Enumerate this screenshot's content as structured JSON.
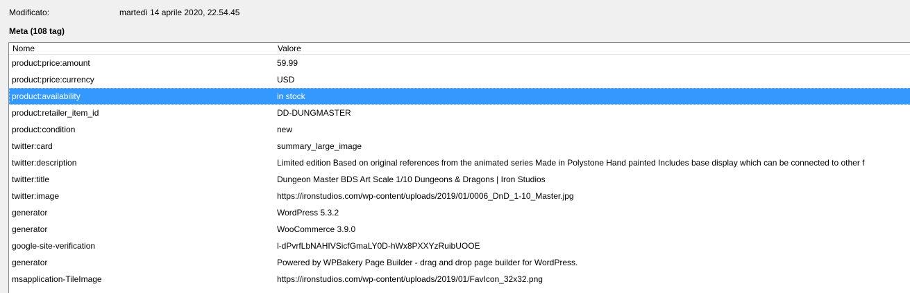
{
  "modified": {
    "label": "Modificato:",
    "value": "martedì 14 aprile 2020, 22.54.45"
  },
  "meta_section": {
    "title": "Meta (108 tag)"
  },
  "table": {
    "columns": [
      "Nome",
      "Valore"
    ],
    "selected_index": 2,
    "rows": [
      {
        "name": "product:price:amount",
        "value": "59.99"
      },
      {
        "name": "product:price:currency",
        "value": "USD"
      },
      {
        "name": "product:availability",
        "value": "in stock"
      },
      {
        "name": "product:retailer_item_id",
        "value": "DD-DUNGMASTER"
      },
      {
        "name": "product:condition",
        "value": "new"
      },
      {
        "name": "twitter:card",
        "value": "summary_large_image"
      },
      {
        "name": "twitter:description",
        "value": "Limited edition Based on original references from the animated series Made in Polystone Hand painted Includes base display which can be connected to other f"
      },
      {
        "name": "twitter:title",
        "value": "Dungeon Master BDS Art Scale 1/10 Dungeons & Dragons | Iron Studios"
      },
      {
        "name": "twitter:image",
        "value": "https://ironstudios.com/wp-content/uploads/2019/01/0006_DnD_1-10_Master.jpg"
      },
      {
        "name": "generator",
        "value": "WordPress 5.3.2"
      },
      {
        "name": "generator",
        "value": "WooCommerce 3.9.0"
      },
      {
        "name": "google-site-verification",
        "value": "l-dPvrfLbNAHIVSicfGmaLY0D-hWx8PXXYzRuibUOOE"
      },
      {
        "name": "generator",
        "value": "Powered by WPBakery Page Builder - drag and drop page builder for WordPress."
      },
      {
        "name": "msapplication-TileImage",
        "value": "https://ironstudios.com/wp-content/uploads/2019/01/FavIcon_32x32.png"
      }
    ]
  }
}
